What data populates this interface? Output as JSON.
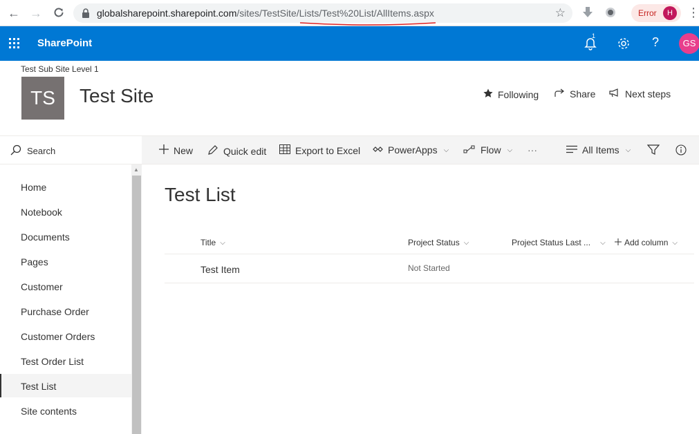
{
  "browser": {
    "url_host": "globalsharepoint.sharepoint.com",
    "url_path": "/sites/TestSite/Lists/Test%20List/AllItems.aspx",
    "error_label": "Error",
    "profile_initial": "H"
  },
  "suite": {
    "brand": "SharePoint",
    "notification_count": "1",
    "help_label": "?",
    "user_initials": "GS",
    "accent_color": "#0078d4"
  },
  "site": {
    "subsite_label": "Test Sub Site Level 1",
    "logo_initials": "TS",
    "title": "Test Site",
    "actions": {
      "following": "Following",
      "share": "Share",
      "next_steps": "Next steps"
    }
  },
  "search": {
    "placeholder": "Search"
  },
  "commands": {
    "new": "New",
    "quick_edit": "Quick edit",
    "export": "Export to Excel",
    "powerapps": "PowerApps",
    "flow": "Flow",
    "more": "···",
    "view": "All Items"
  },
  "nav": {
    "items": [
      "Home",
      "Notebook",
      "Documents",
      "Pages",
      "Customer",
      "Purchase Order",
      "Customer Orders",
      "Test Order List",
      "Test List",
      "Site contents"
    ],
    "selected": "Test List"
  },
  "list": {
    "title": "Test List",
    "columns": [
      "Title",
      "Project Status",
      "Project Status Last ...",
      "Add column"
    ],
    "rows": [
      {
        "title": "Test Item",
        "status": "Not Started"
      }
    ]
  }
}
